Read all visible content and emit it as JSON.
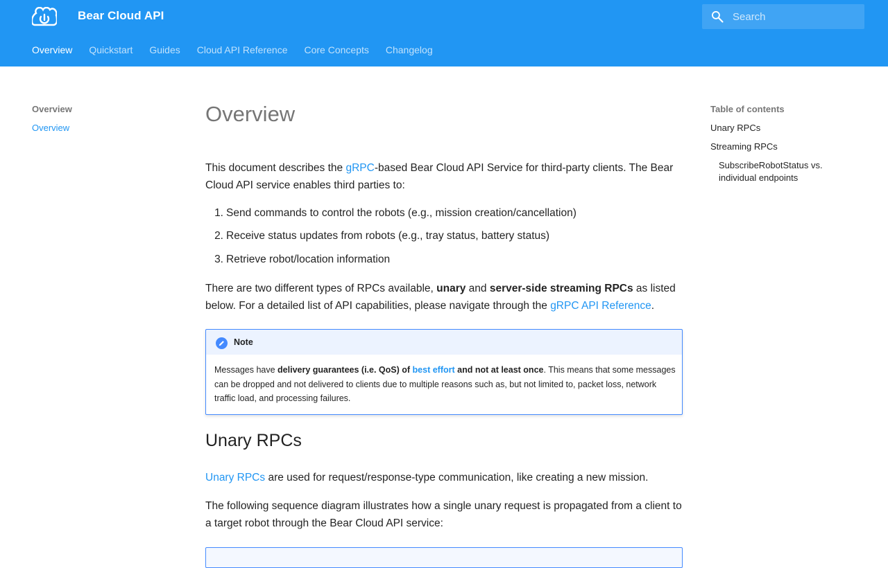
{
  "header": {
    "site_title": "Bear Cloud API",
    "search_placeholder": "Search",
    "tabs": [
      {
        "label": "Overview",
        "active": true
      },
      {
        "label": "Quickstart"
      },
      {
        "label": "Guides"
      },
      {
        "label": "Cloud API Reference"
      },
      {
        "label": "Core Concepts"
      },
      {
        "label": "Changelog"
      }
    ]
  },
  "nav_left": {
    "title": "Overview",
    "items": [
      {
        "label": "Overview"
      }
    ]
  },
  "toc": {
    "title": "Table of contents",
    "items": [
      {
        "label": "Unary RPCs"
      },
      {
        "label": "Streaming RPCs"
      }
    ],
    "sub_items": [
      {
        "label": "SubscribeRobotStatus vs. individual endpoints"
      }
    ]
  },
  "content": {
    "title": "Overview",
    "intro": {
      "prefix": "This document describes the ",
      "link": "gRPC",
      "suffix": "-based Bear Cloud API Service for third-party clients. The Bear Cloud API service enables third parties to:"
    },
    "list": [
      "Send commands to control the robots (e.g., mission creation/cancellation)",
      "Receive status updates from robots (e.g., tray status, battery status)",
      "Retrieve robot/location information"
    ],
    "rpc_types": {
      "t1": "There are two different types of RPCs available, ",
      "b1": "unary",
      "t2": " and ",
      "b2": "server-side streaming RPCs",
      "t3": " as listed below. For a detailed list of API capabilities, please navigate through the ",
      "link": "gRPC API Reference",
      "t4": "."
    },
    "note": {
      "title": "Note",
      "t1": "Messages have ",
      "b1": "delivery guarantees (i.e. QoS) of ",
      "link": "best effort",
      "b2": " and not at least once",
      "t2": ". This means that some messages can be dropped and not delivered to clients due to multiple reasons such as, but not limited to, packet loss, network traffic load, and processing failures."
    },
    "unary_heading": "Unary RPCs",
    "unary_p1": {
      "link": "Unary RPCs",
      "text": " are used for request/response-type communication, like creating a new mission."
    },
    "unary_p2": "The following sequence diagram illustrates how a single unary request is propagated from a client to a target robot through the Bear Cloud API service:"
  },
  "colors": {
    "primary": "#2196f3",
    "note_accent": "#448aff"
  },
  "icons": {
    "logo": "cloud-power-icon",
    "search": "search-icon",
    "note": "pencil-icon"
  }
}
